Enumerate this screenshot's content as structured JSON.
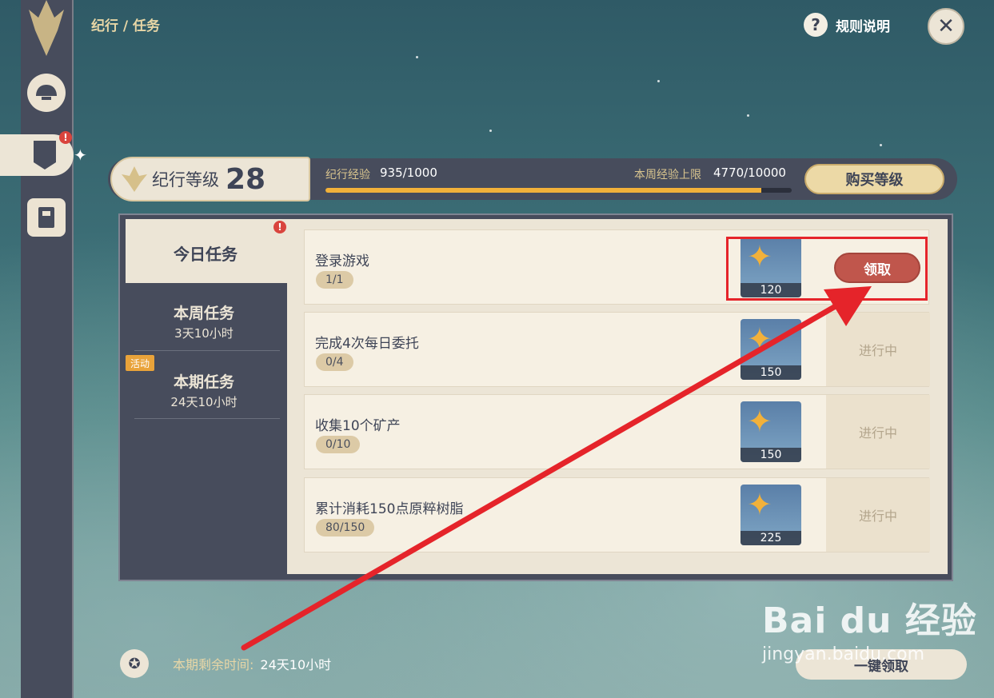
{
  "breadcrumb": "纪行 / 任务",
  "help": {
    "icon": "?",
    "label": "规则说明"
  },
  "close": {
    "icon": "✕"
  },
  "level": {
    "label": "纪行等级",
    "value": "28"
  },
  "xp": {
    "label": "纪行经验",
    "value": "935/1000",
    "progress": 0.935
  },
  "weekly_cap": {
    "label": "本周经验上限",
    "value": "4770/10000"
  },
  "buy_level_label": "购买等级",
  "tabs": [
    {
      "label": "今日任务",
      "sub": ""
    },
    {
      "label": "本周任务",
      "sub": "3天10小时"
    },
    {
      "label": "本期任务",
      "sub": "24天10小时",
      "badge": "活动"
    }
  ],
  "tasks": [
    {
      "name": "登录游戏",
      "progress": "1/1",
      "reward": "120",
      "status": "领取"
    },
    {
      "name": "完成4次每日委托",
      "progress": "0/4",
      "reward": "150",
      "status": "进行中"
    },
    {
      "name": "收集10个矿产",
      "progress": "0/10",
      "reward": "150",
      "status": "进行中"
    },
    {
      "name": "累计消耗150点原粹树脂",
      "progress": "80/150",
      "reward": "225",
      "status": "进行中"
    }
  ],
  "footer": {
    "label": "本期剩余时间:",
    "value": "24天10小时"
  },
  "claim_all_label": "一键领取",
  "watermark": {
    "brand": "Bai du 经验",
    "url": "jingyan.baidu.com"
  },
  "colors": {
    "accent": "#f2b13a",
    "claim": "#c0564c",
    "highlight": "#e5242a",
    "panel": "#474c5c",
    "card": "#ece5d6"
  }
}
